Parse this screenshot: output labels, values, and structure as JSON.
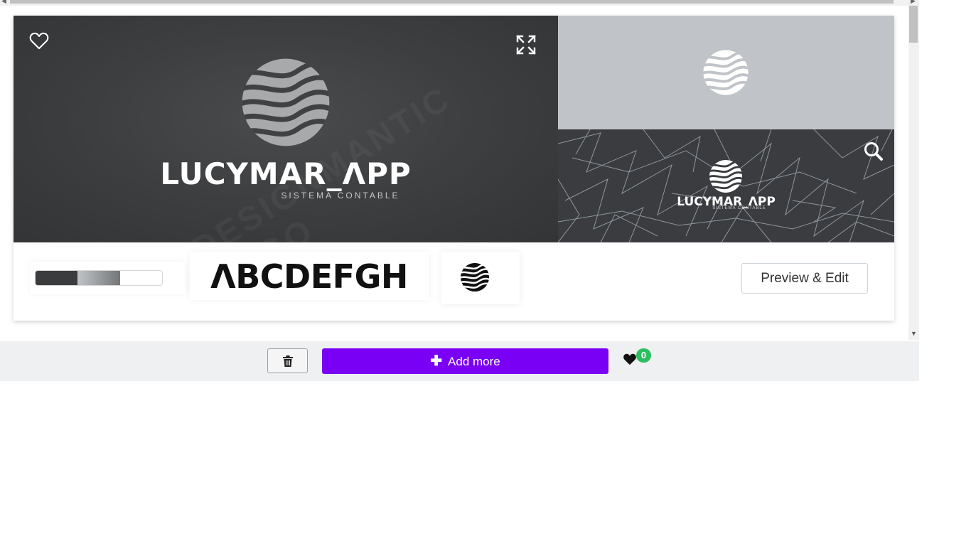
{
  "logo": {
    "name": "LUCYMAR_ΛPP",
    "tagline": "SISTEMA CONTABLE",
    "watermark": "DESIGNMANTIC LOGO"
  },
  "colors": {
    "palette": [
      "#3b3c3e",
      "#c0c4c8",
      "#ffffff"
    ],
    "accent": "#7a00f5",
    "badge": "#2dbe60"
  },
  "font_preview": {
    "sample": "ΛBCDEFGH"
  },
  "buttons": {
    "preview_edit": "Preview & Edit",
    "add_more": "Add more"
  },
  "favorites": {
    "count": "0"
  },
  "icons": [
    "heart-outline-icon",
    "expand-icon",
    "search-icon",
    "trash-icon",
    "plus-icon",
    "heart-icon"
  ]
}
